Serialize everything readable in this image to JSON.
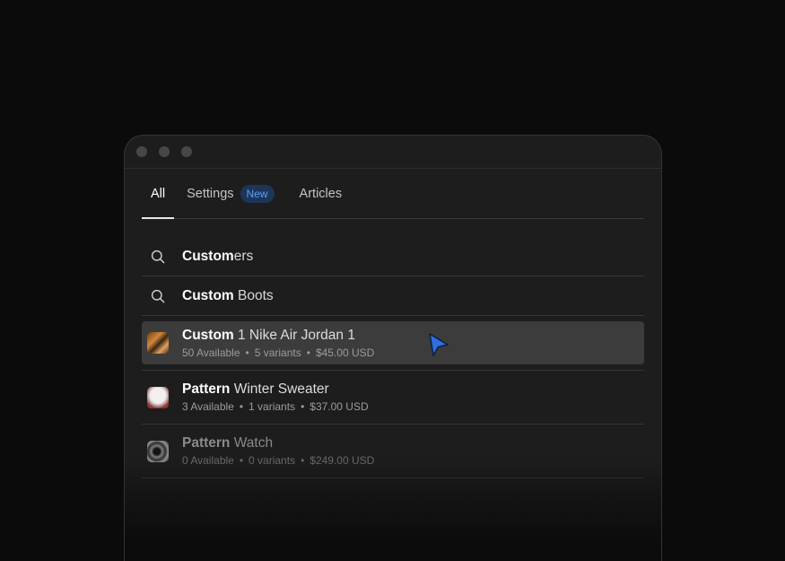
{
  "tabs": [
    {
      "label": "All",
      "active": true
    },
    {
      "label": "Settings",
      "badge": "New"
    },
    {
      "label": "Articles"
    }
  ],
  "suggestions": [
    {
      "bold": "Custom",
      "rest": "ers"
    },
    {
      "bold": "Custom",
      "rest": " Boots"
    }
  ],
  "products": [
    {
      "bold": "Custom",
      "rest": " 1 Nike Air Jordan 1",
      "available": "50 Available",
      "variants": "5 variants",
      "price": "$45.00 USD"
    },
    {
      "bold": "Pattern",
      "rest": " Winter Sweater",
      "available": "3 Available",
      "variants": "1 variants",
      "price": "$37.00 USD"
    },
    {
      "bold": "Pattern",
      "rest": " Watch",
      "available": "0 Available",
      "variants": "0 variants",
      "price": "$249.00 USD"
    }
  ],
  "meta_separator": "•",
  "colors": {
    "background": "#0b0b0b",
    "window": "#1d1d1d",
    "highlight_row": "#3c3c3c",
    "badge_bg": "#1c3559",
    "badge_text": "#5ea1f5",
    "cursor": "#2f6fe0"
  },
  "icons": {
    "search_rows": "search-icon",
    "pointer": "pointer-cursor-icon"
  }
}
